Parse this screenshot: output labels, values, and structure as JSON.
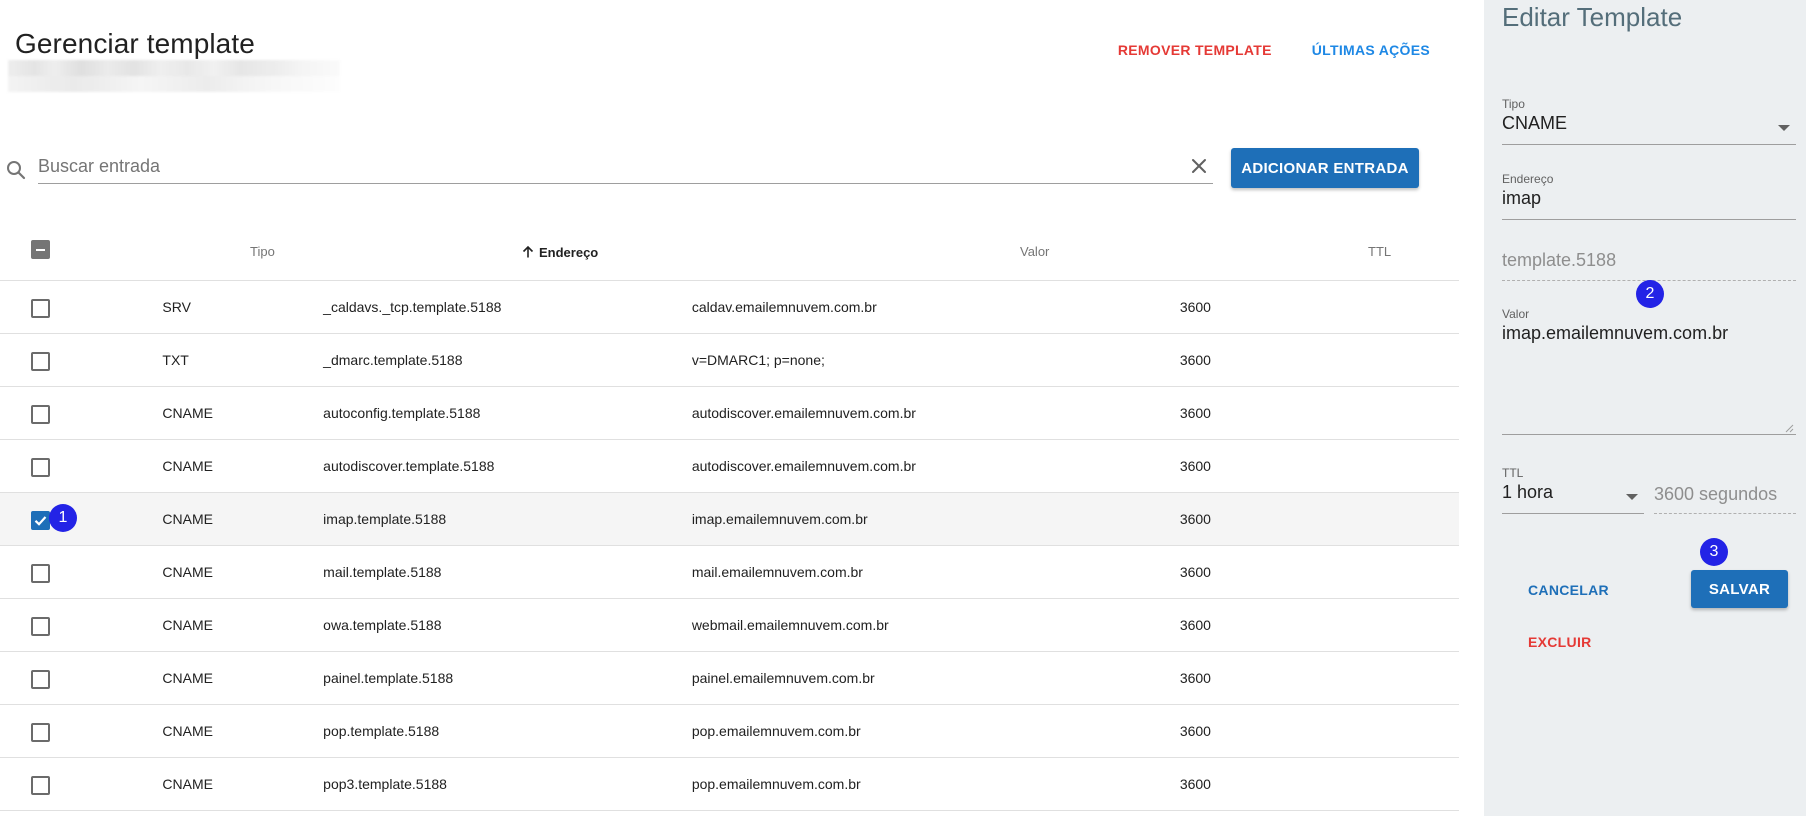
{
  "header": {
    "title": "Gerenciar template",
    "remove_label": "REMOVER TEMPLATE",
    "history_label": "ÚLTIMAS AÇÕES"
  },
  "search": {
    "placeholder": "Buscar entrada",
    "value": "",
    "add_label": "ADICIONAR ENTRADA"
  },
  "table": {
    "columns": {
      "tipo": "Tipo",
      "endereco": "Endereço",
      "valor": "Valor",
      "ttl": "TTL"
    },
    "sort_column": "Endereço",
    "sort_direction": "asc",
    "rows": [
      {
        "tipo": "SRV",
        "endereco": "_caldavs._tcp.template.5188",
        "valor": "caldav.emailemnuvem.com.br",
        "ttl": "3600",
        "checked": false
      },
      {
        "tipo": "TXT",
        "endereco": "_dmarc.template.5188",
        "valor": "v=DMARC1; p=none;",
        "ttl": "3600",
        "checked": false
      },
      {
        "tipo": "CNAME",
        "endereco": "autoconfig.template.5188",
        "valor": "autodiscover.emailemnuvem.com.br",
        "ttl": "3600",
        "checked": false
      },
      {
        "tipo": "CNAME",
        "endereco": "autodiscover.template.5188",
        "valor": "autodiscover.emailemnuvem.com.br",
        "ttl": "3600",
        "checked": false
      },
      {
        "tipo": "CNAME",
        "endereco": "imap.template.5188",
        "valor": "imap.emailemnuvem.com.br",
        "ttl": "3600",
        "checked": true
      },
      {
        "tipo": "CNAME",
        "endereco": "mail.template.5188",
        "valor": "mail.emailemnuvem.com.br",
        "ttl": "3600",
        "checked": false
      },
      {
        "tipo": "CNAME",
        "endereco": "owa.template.5188",
        "valor": "webmail.emailemnuvem.com.br",
        "ttl": "3600",
        "checked": false
      },
      {
        "tipo": "CNAME",
        "endereco": "painel.template.5188",
        "valor": "painel.emailemnuvem.com.br",
        "ttl": "3600",
        "checked": false
      },
      {
        "tipo": "CNAME",
        "endereco": "pop.template.5188",
        "valor": "pop.emailemnuvem.com.br",
        "ttl": "3600",
        "checked": false
      },
      {
        "tipo": "CNAME",
        "endereco": "pop3.template.5188",
        "valor": "pop.emailemnuvem.com.br",
        "ttl": "3600",
        "checked": false
      }
    ]
  },
  "panel": {
    "title": "Editar Template",
    "tipo_label": "Tipo",
    "tipo_value": "CNAME",
    "endereco_label": "Endereço",
    "endereco_value": "imap",
    "domain_suffix": "template.5188",
    "valor_label": "Valor",
    "valor_value": "imap.emailemnuvem.com.br",
    "ttl_label": "TTL",
    "ttl_value": "1 hora",
    "ttl_seconds": "3600 segundos",
    "cancel_label": "CANCELAR",
    "save_label": "SALVAR",
    "delete_label": "EXCLUIR"
  },
  "steps": [
    "1",
    "2",
    "3"
  ],
  "icons": {
    "search": "search-icon",
    "clear": "close-icon",
    "sort": "arrow-up-icon",
    "dropdown": "caret-down-icon",
    "check": "check-icon"
  },
  "colors": {
    "primary": "#1e6fb8",
    "danger": "#e53935",
    "link": "#1e88e5",
    "step_badge": "#2323e6",
    "panel_bg": "#eceff1"
  }
}
